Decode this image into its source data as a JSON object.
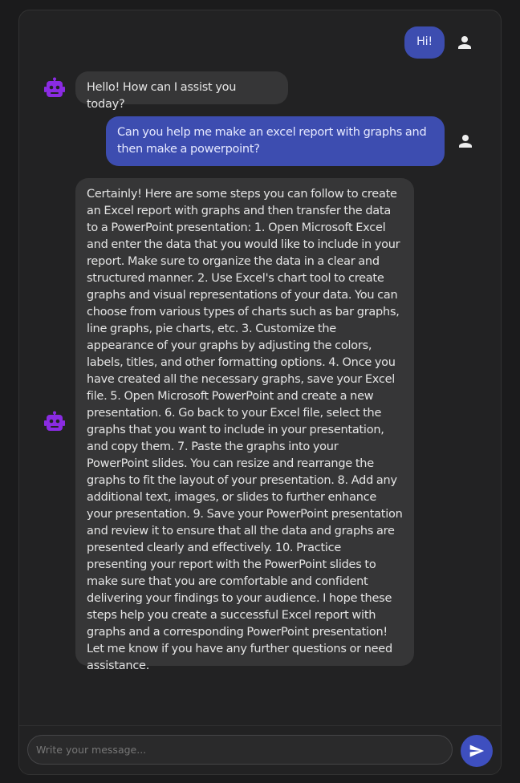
{
  "messages": [
    {
      "sender": "user",
      "avatar_icon": "person-icon",
      "text": "Hi!"
    },
    {
      "sender": "bot",
      "avatar_icon": "robot-icon",
      "text": "Hello! How can I assist you today?"
    },
    {
      "sender": "user",
      "avatar_icon": "person-icon",
      "text": "Can you help me make an excel report with graphs and then make a powerpoint?"
    },
    {
      "sender": "bot",
      "avatar_icon": "robot-icon",
      "text": "Certainly! Here are some steps you can follow to create an Excel report with graphs and then transfer the data to a PowerPoint presentation: 1. Open Microsoft Excel and enter the data that you would like to include in your report. Make sure to organize the data in a clear and structured manner. 2. Use Excel's chart tool to create graphs and visual representations of your data. You can choose from various types of charts such as bar graphs, line graphs, pie charts, etc. 3. Customize the appearance of your graphs by adjusting the colors, labels, titles, and other formatting options. 4. Once you have created all the necessary graphs, save your Excel file. 5. Open Microsoft PowerPoint and create a new presentation. 6. Go back to your Excel file, select the graphs that you want to include in your presentation, and copy them. 7. Paste the graphs into your PowerPoint slides. You can resize and rearrange the graphs to fit the layout of your presentation. 8. Add any additional text, images, or slides to further enhance your presentation. 9. Save your PowerPoint presentation and review it to ensure that all the data and graphs are presented clearly and effectively. 10. Practice presenting your report with the PowerPoint slides to make sure that you are comfortable and confident delivering your findings to your audience. I hope these steps help you create a successful Excel report with graphs and a corresponding PowerPoint presentation! Let me know if you have any further questions or need assistance."
    }
  ],
  "composer": {
    "placeholder": "Write your message...",
    "send_icon": "send-icon"
  },
  "colors": {
    "user_bubble": "#3d4db0",
    "bot_bubble": "#363637",
    "bot_avatar": "#8a2be2",
    "send_button": "#3e4fbf"
  }
}
